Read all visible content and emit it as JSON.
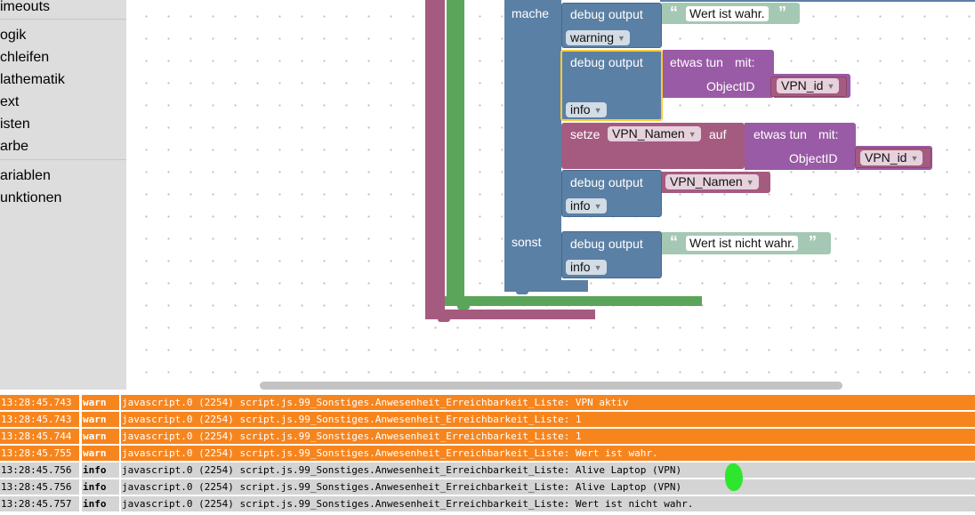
{
  "toolbox": {
    "categories": [
      "imeouts",
      "ogik",
      "chleifen",
      "lathematik",
      "ext",
      "isten",
      "arbe",
      "ariablen",
      "unktionen"
    ]
  },
  "workspace": {
    "if_block": {
      "do_label": "mache",
      "else_label": "sonst",
      "statements": {
        "debug1": {
          "label": "debug output",
          "level": "warning",
          "value": "Wert ist wahr."
        },
        "debug2": {
          "label": "debug output",
          "level": "info",
          "call": {
            "label": "etwas tun",
            "mit": "mit:",
            "param": "ObjectID",
            "var": "VPN_id"
          }
        },
        "set": {
          "label": "setze",
          "var": "VPN_Namen",
          "auf": "auf",
          "call": {
            "label": "etwas tun",
            "mit": "mit:",
            "param": "ObjectID",
            "var": "VPN_id"
          }
        },
        "debug3": {
          "label": "debug output",
          "level": "info",
          "var": "VPN_Namen"
        },
        "debug4": {
          "label": "debug output",
          "level": "info",
          "value": "Wert ist nicht wahr."
        }
      }
    },
    "dropdown_arrow": "▼",
    "quote_open": "“",
    "quote_close": "”"
  },
  "log": {
    "rows": [
      {
        "time": "13:28:45.743",
        "level": "warn",
        "msg": "javascript.0 (2254) script.js.99_Sonstiges.Anwesenheit_Erreichbarkeit_Liste: VPN aktiv"
      },
      {
        "time": "13:28:45.743",
        "level": "warn",
        "msg": "javascript.0 (2254) script.js.99_Sonstiges.Anwesenheit_Erreichbarkeit_Liste: 1"
      },
      {
        "time": "13:28:45.744",
        "level": "warn",
        "msg": "javascript.0 (2254) script.js.99_Sonstiges.Anwesenheit_Erreichbarkeit_Liste: 1"
      },
      {
        "time": "13:28:45.755",
        "level": "warn",
        "msg": "javascript.0 (2254) script.js.99_Sonstiges.Anwesenheit_Erreichbarkeit_Liste: Wert ist wahr."
      },
      {
        "time": "13:28:45.756",
        "level": "info",
        "msg": "javascript.0 (2254) script.js.99_Sonstiges.Anwesenheit_Erreichbarkeit_Liste: Alive Laptop (VPN)"
      },
      {
        "time": "13:28:45.756",
        "level": "info",
        "msg": "javascript.0 (2254) script.js.99_Sonstiges.Anwesenheit_Erreichbarkeit_Liste: Alive Laptop (VPN)"
      },
      {
        "time": "13:28:45.757",
        "level": "info",
        "msg": "javascript.0 (2254) script.js.99_Sonstiges.Anwesenheit_Erreichbarkeit_Liste: Wert ist nicht wahr."
      }
    ]
  },
  "colors": {
    "warn_row": "#f7851e",
    "info_row": "#d4d4d4",
    "procedure_block": "#a55b80",
    "loop_block": "#5ba55b",
    "logic_block": "#5b80a5",
    "text_block": "#a5c8b5",
    "variable_block": "#a55b80",
    "function_block": "#995ba5",
    "selected_outline": "#fc3"
  }
}
